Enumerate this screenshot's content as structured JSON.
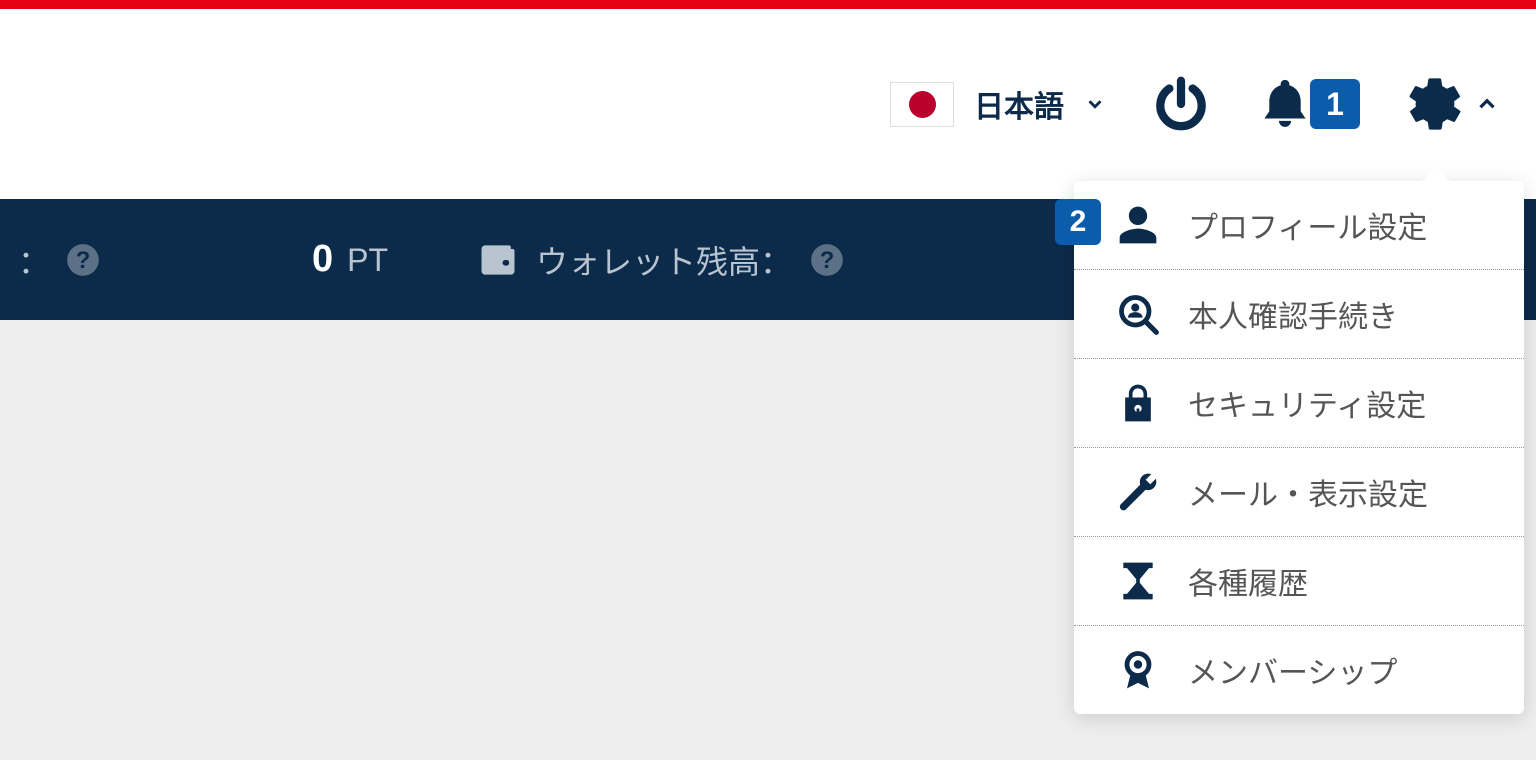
{
  "header": {
    "language_label": "日本語",
    "notification_count": "1"
  },
  "status_bar": {
    "colon": "：",
    "pt_value": "0",
    "pt_unit": "PT",
    "wallet_label": "ウォレット残高："
  },
  "settings_menu": {
    "profile_badge": "2",
    "items": [
      {
        "label": "プロフィール設定"
      },
      {
        "label": "本人確認手続き"
      },
      {
        "label": "セキュリティ設定"
      },
      {
        "label": "メール・表示設定"
      },
      {
        "label": "各種履歴"
      },
      {
        "label": "メンバーシップ"
      }
    ]
  }
}
